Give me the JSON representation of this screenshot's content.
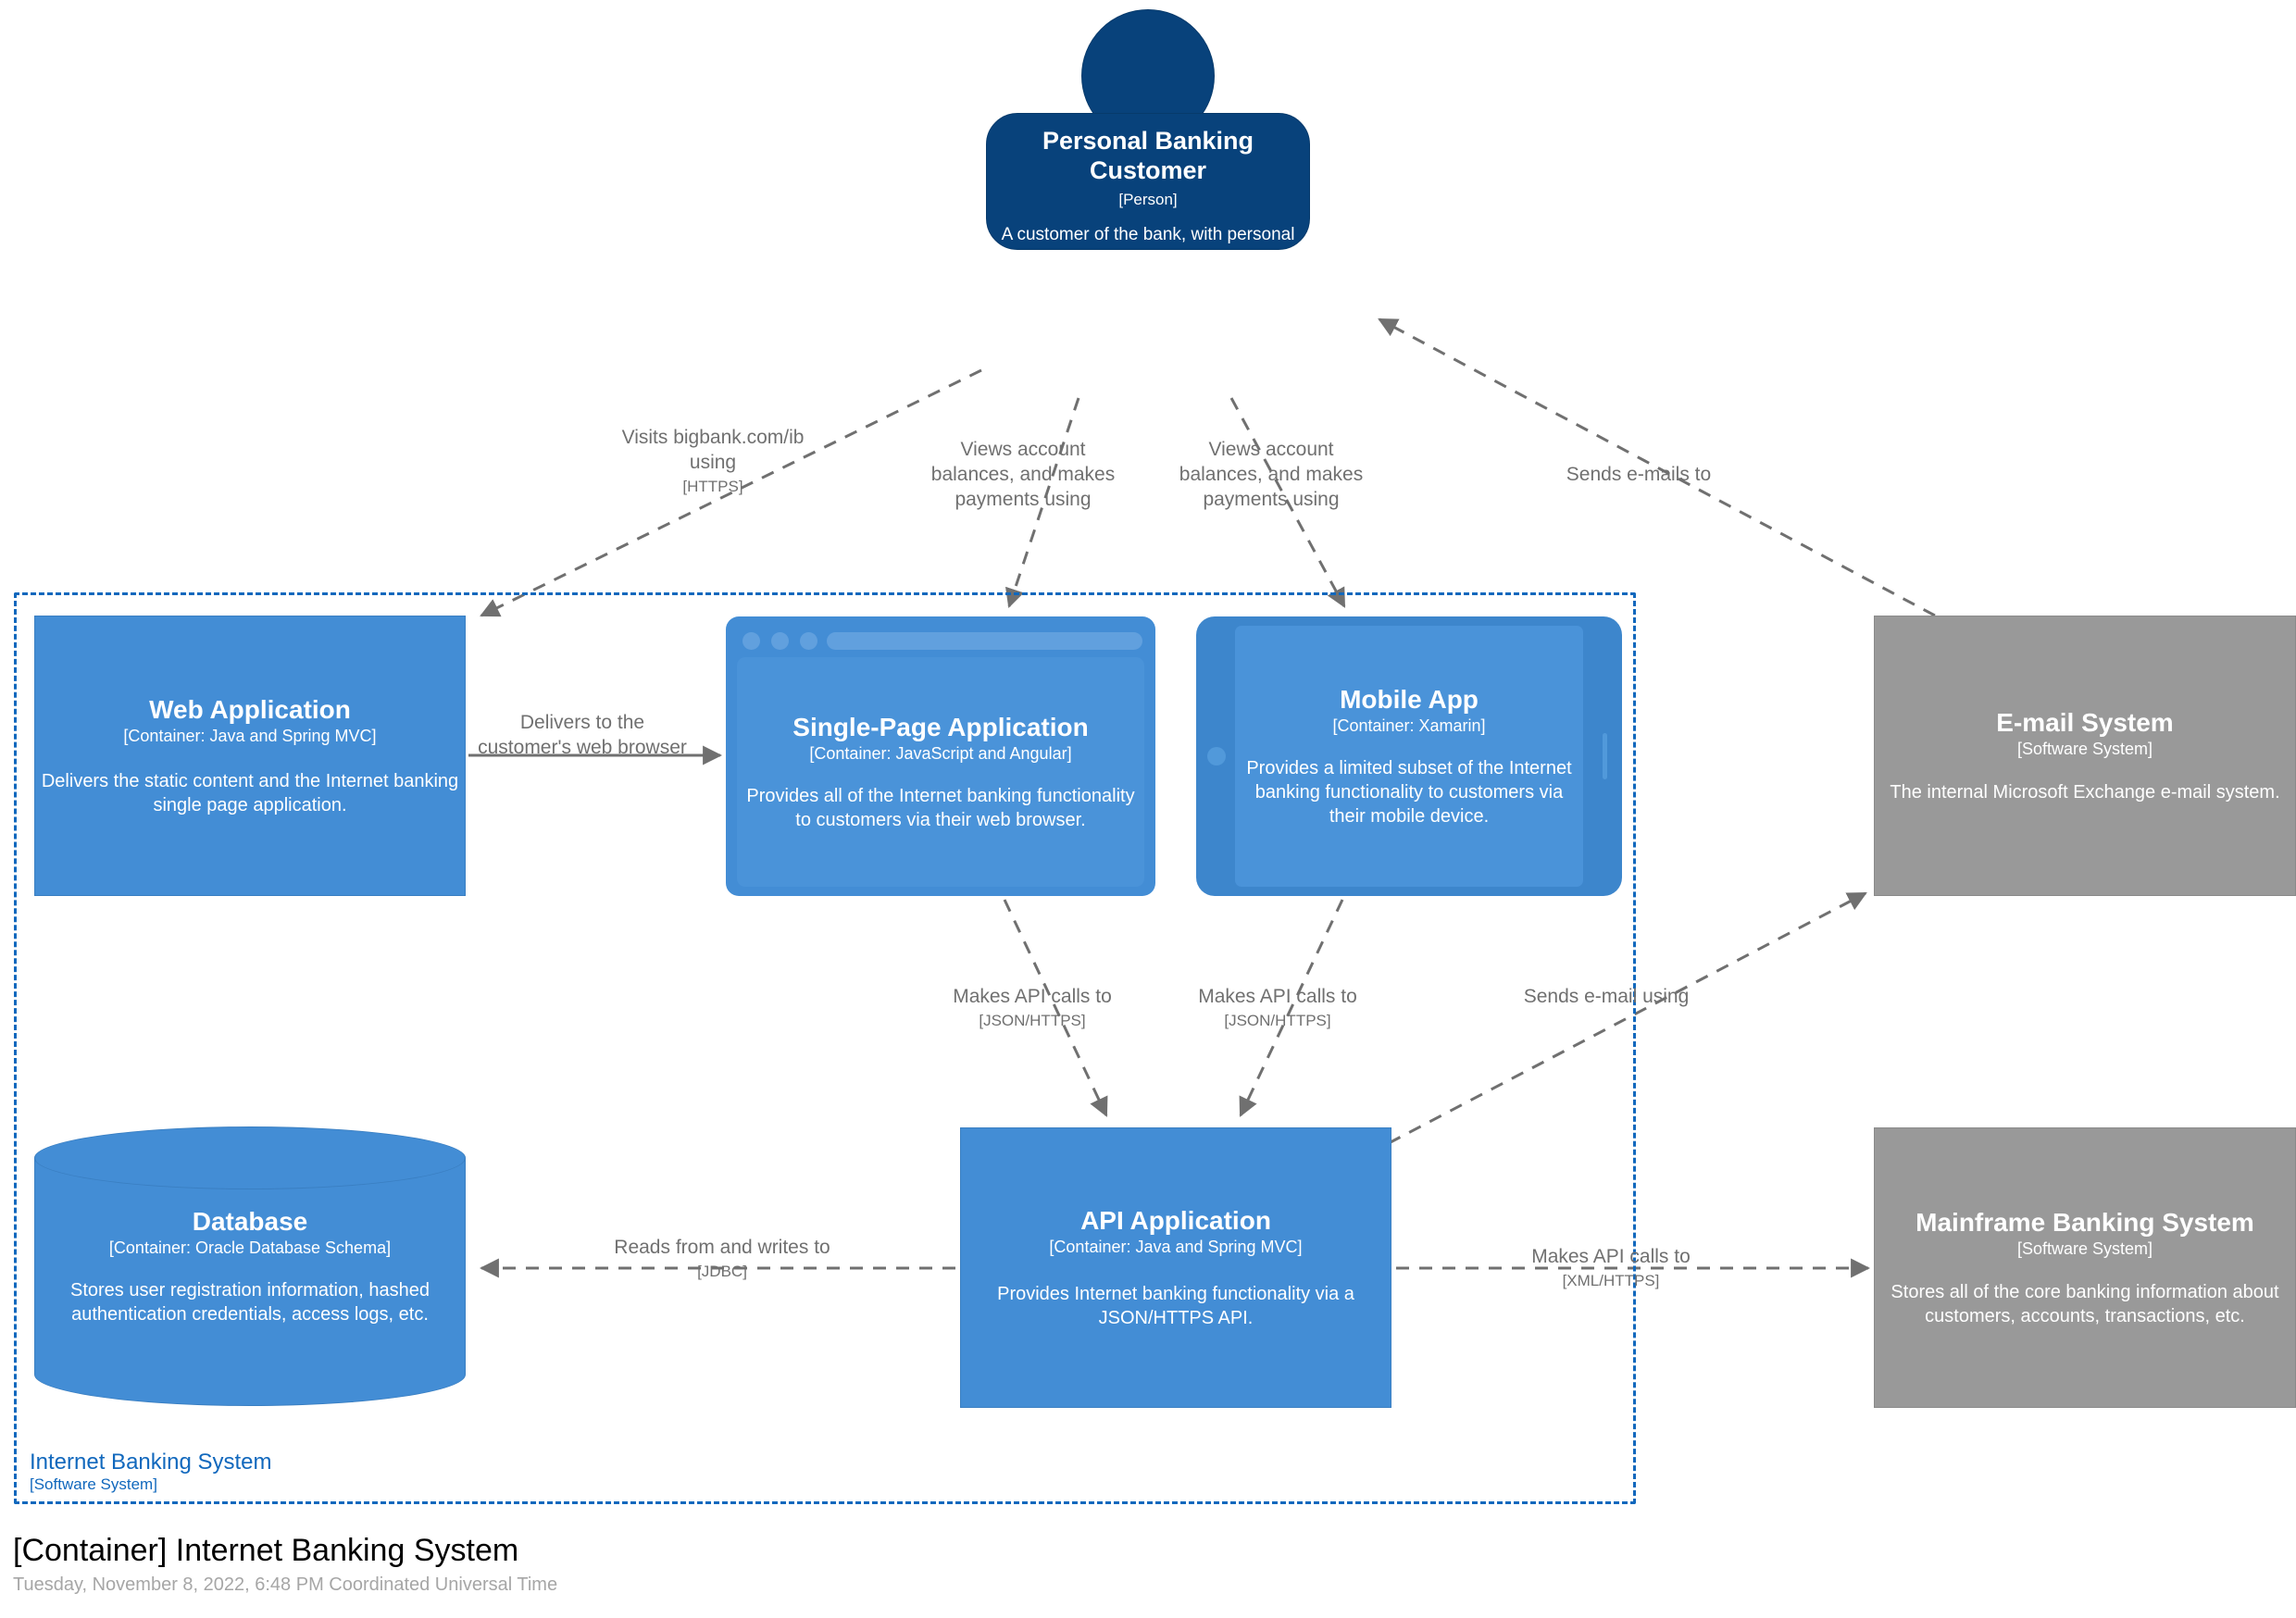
{
  "diagram": {
    "title": "[Container] Internet Banking System",
    "date": "Tuesday, November 8, 2022, 6:48 PM Coordinated Universal Time",
    "colors": {
      "person": "#08427b",
      "container": "#438dd5",
      "external": "#999999",
      "boundary": "#1168bd",
      "edge": "#707070"
    }
  },
  "boundary": {
    "name": "Internet Banking System",
    "type": "[Software System]"
  },
  "nodes": {
    "person": {
      "title": "Personal Banking Customer",
      "tech": "[Person]",
      "desc": "A customer of the bank, with personal bank accounts."
    },
    "web_application": {
      "title": "Web Application",
      "tech": "[Container: Java and Spring MVC]",
      "desc": "Delivers the static content and the Internet banking single page application."
    },
    "single_page_application": {
      "title": "Single-Page Application",
      "tech": "[Container: JavaScript and Angular]",
      "desc": "Provides all of the Internet banking functionality to customers via their web browser."
    },
    "mobile_app": {
      "title": "Mobile App",
      "tech": "[Container: Xamarin]",
      "desc": "Provides a limited subset of the Internet banking functionality to customers via their mobile device."
    },
    "database": {
      "title": "Database",
      "tech": "[Container: Oracle Database Schema]",
      "desc": "Stores user registration information, hashed authentication credentials, access logs, etc."
    },
    "api_application": {
      "title": "API Application",
      "tech": "[Container: Java and Spring MVC]",
      "desc": "Provides Internet banking functionality via a JSON/HTTPS API."
    },
    "email_system": {
      "title": "E-mail System",
      "tech": "[Software System]",
      "desc": "The internal Microsoft Exchange e-mail system."
    },
    "mainframe_banking_system": {
      "title": "Mainframe Banking System",
      "tech": "[Software System]",
      "desc": "Stores all of the core banking information about customers, accounts, transactions, etc."
    }
  },
  "edges": {
    "visits": {
      "label": "Visits bigbank.com/ib using",
      "tech": "[HTTPS]"
    },
    "views_balances_spa": {
      "label": "Views account balances, and makes payments using",
      "tech": ""
    },
    "views_balances_mobile": {
      "label": "Views account balances, and makes payments using",
      "tech": ""
    },
    "sends_emails_to": {
      "label": "Sends e-mails to",
      "tech": ""
    },
    "delivers": {
      "label": "Delivers to the customer's web browser",
      "tech": ""
    },
    "spa_api_calls": {
      "label": "Makes API calls to",
      "tech": "[JSON/HTTPS]"
    },
    "mobile_api_calls": {
      "label": "Makes API calls to",
      "tech": "[JSON/HTTPS]"
    },
    "sends_email_using": {
      "label": "Sends e-mail using",
      "tech": ""
    },
    "reads_writes": {
      "label": "Reads from and writes to",
      "tech": "[JDBC]"
    },
    "mainframe_api_calls": {
      "label": "Makes API calls to",
      "tech": "[XML/HTTPS]"
    }
  }
}
